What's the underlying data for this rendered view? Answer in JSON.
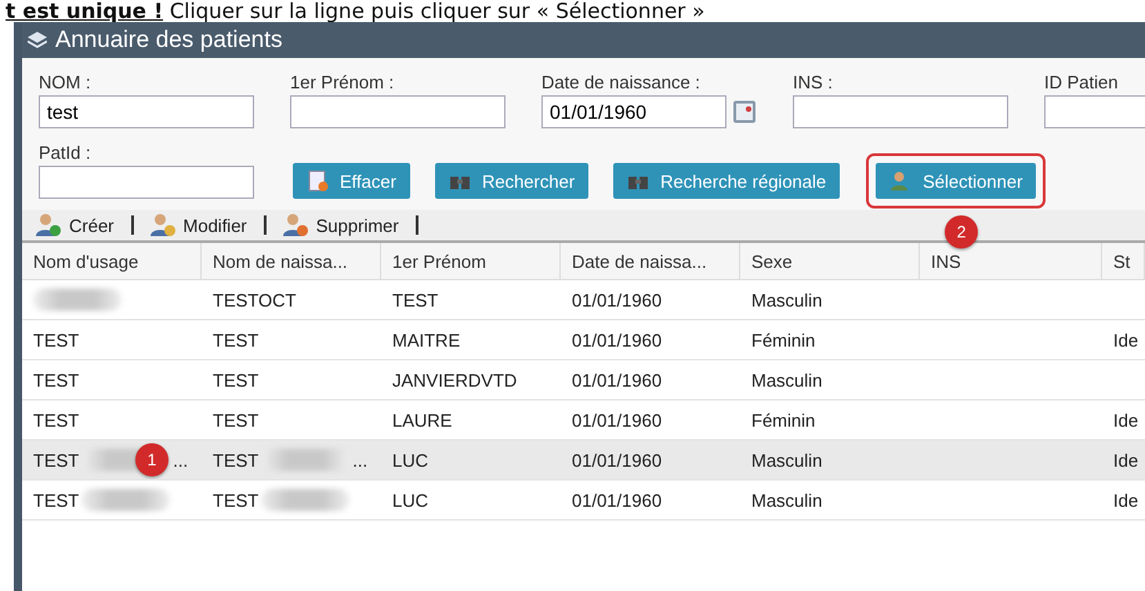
{
  "instruction": {
    "underlined": "t est unique !",
    "rest": " Cliquer sur la ligne puis cliquer sur « Sélectionner »"
  },
  "window": {
    "title": "Annuaire des patients"
  },
  "fields": [
    {
      "label": "NOM :",
      "value": "test",
      "kind": "text"
    },
    {
      "label": "1er Prénom :",
      "kind": "text"
    },
    {
      "label": "Date de naissance :",
      "value": "01/01/1960",
      "kind": "date"
    },
    {
      "label": "INS :",
      "kind": "text"
    },
    {
      "label": "ID Patien",
      "kind": "text"
    }
  ],
  "patid": {
    "label": "PatId :"
  },
  "buttons": [
    {
      "label": "Effacer",
      "kind": "clear"
    },
    {
      "label": "Rechercher",
      "kind": "search"
    },
    {
      "label": "Recherche régionale",
      "kind": "search"
    },
    {
      "label": "Sélectionner",
      "kind": "select",
      "highlighted": true,
      "badge": "2"
    }
  ],
  "toolbar": [
    {
      "label": "Créer",
      "kind": "add"
    },
    {
      "label": "Modifier",
      "kind": "edit"
    },
    {
      "label": "Supprimer",
      "kind": "delete"
    }
  ],
  "table": {
    "columns": [
      "Nom d'usage",
      "Nom de naissa...",
      "1er Prénom",
      "Date de naissa...",
      "Sexe",
      "INS",
      "St"
    ],
    "rows": [
      {
        "selected": false,
        "cells": [
          {
            "text": "",
            "blurred": true
          },
          {
            "text": "TESTOCT"
          },
          {
            "text": "TEST"
          },
          {
            "text": "01/01/1960"
          },
          {
            "text": "Masculin"
          },
          {
            "text": ""
          },
          {
            "text": ""
          }
        ]
      },
      {
        "selected": false,
        "cells": [
          {
            "text": "TEST"
          },
          {
            "text": "TEST"
          },
          {
            "text": "MAITRE"
          },
          {
            "text": "01/01/1960"
          },
          {
            "text": "Féminin"
          },
          {
            "text": ""
          },
          {
            "text": "Ide"
          }
        ]
      },
      {
        "selected": false,
        "cells": [
          {
            "text": "TEST"
          },
          {
            "text": "TEST"
          },
          {
            "text": "JANVIERDVTD"
          },
          {
            "text": "01/01/1960"
          },
          {
            "text": "Masculin"
          },
          {
            "text": ""
          },
          {
            "text": ""
          }
        ]
      },
      {
        "selected": false,
        "cells": [
          {
            "text": "TEST"
          },
          {
            "text": "TEST"
          },
          {
            "text": "LAURE"
          },
          {
            "text": "01/01/1960"
          },
          {
            "text": "Féminin"
          },
          {
            "text": ""
          },
          {
            "text": "Ide"
          }
        ]
      },
      {
        "selected": true,
        "badge": "1",
        "cells": [
          {
            "text": "TEST",
            "blurred": true,
            "suffix": "..."
          },
          {
            "text": "TEST",
            "blurred": true,
            "suffix": "..."
          },
          {
            "text": "LUC"
          },
          {
            "text": "01/01/1960"
          },
          {
            "text": "Masculin"
          },
          {
            "text": ""
          },
          {
            "text": "Ide"
          }
        ]
      },
      {
        "selected": false,
        "cells": [
          {
            "text": "TEST",
            "blurred": true
          },
          {
            "text": "TEST",
            "blurred": true
          },
          {
            "text": "LUC"
          },
          {
            "text": "01/01/1960"
          },
          {
            "text": "Masculin"
          },
          {
            "text": ""
          },
          {
            "text": "Ide"
          }
        ]
      }
    ]
  }
}
